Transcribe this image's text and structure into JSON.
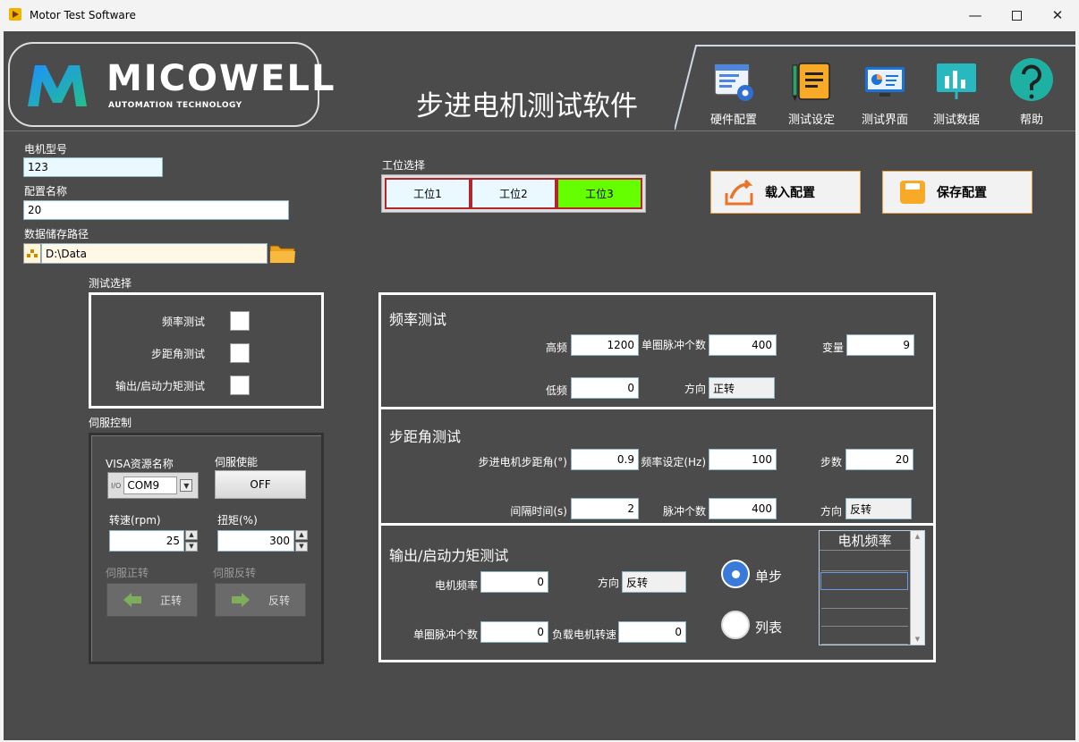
{
  "window": {
    "title": "Motor Test Software"
  },
  "header": {
    "brand_name": "MICOWELL",
    "brand_sub": "AUTOMATION TECHNOLOGY",
    "app_title": "步进电机测试软件",
    "toolbar": [
      {
        "label": "硬件配置",
        "icon": "hardware-config-icon"
      },
      {
        "label": "测试设定",
        "icon": "notepad-icon"
      },
      {
        "label": "测试界面",
        "icon": "monitor-chart-icon"
      },
      {
        "label": "测试数据",
        "icon": "data-chart-icon"
      },
      {
        "label": "帮助",
        "icon": "help-icon"
      }
    ]
  },
  "config": {
    "motor_model_label": "电机型号",
    "motor_model_value": "123",
    "config_name_label": "配置名称",
    "config_name_value": "20",
    "data_path_label": "数据储存路径",
    "data_path_value": "D:\\Data"
  },
  "station": {
    "label": "工位选择",
    "items": [
      {
        "label": "工位1",
        "color": "#eaf8ff"
      },
      {
        "label": "工位2",
        "color": "#eaf8ff"
      },
      {
        "label": "工位3",
        "color": "#66ff00"
      }
    ]
  },
  "actions": {
    "load_label": "载入配置",
    "save_label": "保存配置"
  },
  "test_select": {
    "label": "测试选择",
    "items": [
      {
        "label": "频率测试",
        "checked": false
      },
      {
        "label": "步距角测试",
        "checked": false
      },
      {
        "label": "输出/启动力矩测试",
        "checked": false
      }
    ]
  },
  "servo": {
    "label": "伺服控制",
    "visa_label": "VISA资源名称",
    "visa_prefix": "I/O",
    "visa_value": "COM9",
    "enable_label": "伺服使能",
    "enable_value": "OFF",
    "speed_label": "转速(rpm)",
    "speed_value": "25",
    "torque_label": "扭矩(%)",
    "torque_value": "300",
    "forward_label": "伺服正转",
    "forward_btn": "正转",
    "reverse_label": "伺服反转",
    "reverse_btn": "反转"
  },
  "freq_test": {
    "title": "频率测试",
    "high_label": "高频",
    "high_value": "1200",
    "pulse_label": "单圈脉冲个数",
    "pulse_value": "400",
    "var_label": "变量",
    "var_value": "9",
    "low_label": "低频",
    "low_value": "0",
    "dir_label": "方向",
    "dir_value": "正转"
  },
  "step_test": {
    "title": "步距角测试",
    "angle_label": "步进电机步距角(°)",
    "angle_value": "0.9",
    "freq_label": "频率设定(Hz)",
    "freq_value": "100",
    "steps_label": "步数",
    "steps_value": "20",
    "interval_label": "间隔时间(s)",
    "interval_value": "2",
    "pulses_label": "脉冲个数",
    "pulses_value": "400",
    "dir_label": "方向",
    "dir_value": "反转"
  },
  "torque_test": {
    "title": "输出/启动力矩测试",
    "motor_freq_label": "电机频率",
    "motor_freq_value": "0",
    "dir_label": "方向",
    "dir_value": "反转",
    "pulse_label": "单圈脉冲个数",
    "pulse_value": "0",
    "load_speed_label": "负载电机转速",
    "load_speed_value": "0",
    "radio_single": "单步",
    "radio_list": "列表",
    "selected_mode": "单步",
    "table_header": "电机频率"
  }
}
